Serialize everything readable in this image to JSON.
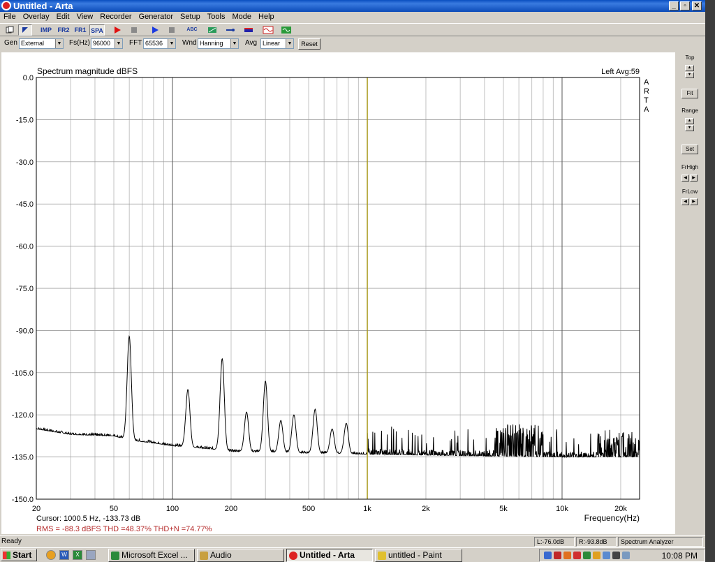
{
  "window": {
    "title": "Untitled - Arta",
    "controls": [
      "_",
      "▫",
      "✕"
    ]
  },
  "menu": [
    "File",
    "Overlay",
    "Edit",
    "View",
    "Recorder",
    "Generator",
    "Setup",
    "Tools",
    "Mode",
    "Help"
  ],
  "toolbar": {
    "imp_label": "IMP",
    "fr2_label": "FR2",
    "fr1_label": "FR1",
    "spa_label": "SPA",
    "rabc_label": "ABC"
  },
  "controls": {
    "gen_label": "Gen",
    "gen_value": "External",
    "fs_label": "Fs(Hz)",
    "fs_value": "96000",
    "fft_label": "FFT",
    "fft_value": "65536",
    "wnd_label": "Wnd",
    "wnd_value": "Hanning",
    "avg_label": "Avg",
    "avg_value": "Linear",
    "reset_label": "Reset"
  },
  "plot": {
    "title": "Spectrum magnitude dBFS",
    "channel_avg": "Left  Avg:59",
    "watermark": "A\nR\nT\nA",
    "cursor_text": "Cursor:  1000.5 Hz, -133.73 dB",
    "measurement_text": "RMS =  -88.3 dBFS   THD =48.37%   THD+N =74.77%",
    "x_axis_label": "Frequency(Hz)"
  },
  "chart_data": {
    "type": "line",
    "title": "Spectrum magnitude dBFS",
    "xlabel": "Frequency(Hz)",
    "ylabel": "",
    "x_scale": "log",
    "xlim": [
      20,
      25000
    ],
    "ylim": [
      -150,
      0
    ],
    "y_ticks": [
      "0.0",
      "-15.0",
      "-30.0",
      "-45.0",
      "-60.0",
      "-75.0",
      "-90.0",
      "-105.0",
      "-120.0",
      "-135.0",
      "-150.0"
    ],
    "x_ticks": [
      {
        "value": 20,
        "label": "20"
      },
      {
        "value": 50,
        "label": "50"
      },
      {
        "value": 100,
        "label": "100"
      },
      {
        "value": 200,
        "label": "200"
      },
      {
        "value": 500,
        "label": "500"
      },
      {
        "value": 1000,
        "label": "1k"
      },
      {
        "value": 2000,
        "label": "2k"
      },
      {
        "value": 5000,
        "label": "5k"
      },
      {
        "value": 10000,
        "label": "10k"
      },
      {
        "value": 20000,
        "label": "20k"
      }
    ],
    "cursor_frequency": 1000.5,
    "cursor_level": -133.73,
    "baseline_points": [
      [
        20,
        -125
      ],
      [
        30,
        -127
      ],
      [
        50,
        -127.5
      ],
      [
        60,
        -129
      ],
      [
        80,
        -130
      ],
      [
        100,
        -131
      ],
      [
        150,
        -132
      ],
      [
        200,
        -133
      ],
      [
        400,
        -133.5
      ],
      [
        1000,
        -134
      ],
      [
        3000,
        -134.5
      ],
      [
        10000,
        -135
      ],
      [
        25000,
        -135
      ]
    ],
    "peaks": [
      {
        "freq": 60,
        "level": -92
      },
      {
        "freq": 120,
        "level": -111
      },
      {
        "freq": 180,
        "level": -100
      },
      {
        "freq": 240,
        "level": -119
      },
      {
        "freq": 300,
        "level": -108
      },
      {
        "freq": 360,
        "level": -122
      },
      {
        "freq": 420,
        "level": -120
      },
      {
        "freq": 540,
        "level": -118
      },
      {
        "freq": 660,
        "level": -125
      },
      {
        "freq": 780,
        "level": -123
      }
    ],
    "noise_clusters": [
      {
        "from": 4500,
        "to": 8000,
        "level": -125
      },
      {
        "from": 15000,
        "to": 25000,
        "level": -128
      }
    ]
  },
  "right_panel": {
    "top_label": "Top",
    "fit_label": "Fit",
    "range_label": "Range",
    "set_label": "Set",
    "frhigh_label": "FrHigh",
    "frlow_label": "FrLow"
  },
  "status": {
    "ready": "Ready",
    "left_level": "L:-76.0dB",
    "right_level": "R:-93.8dB",
    "mode": "Spectrum Analyzer"
  },
  "taskbar": {
    "start_label": "Start",
    "tasks": [
      "Microsoft Excel ...",
      "Audio",
      "Untitled - Arta",
      "untitled - Paint"
    ],
    "clock": "10:08 PM"
  },
  "colors": {
    "cursor_line": "#a89a1a",
    "measurement_text": "#b52a2a",
    "titlebar": "#0a4fc0"
  }
}
